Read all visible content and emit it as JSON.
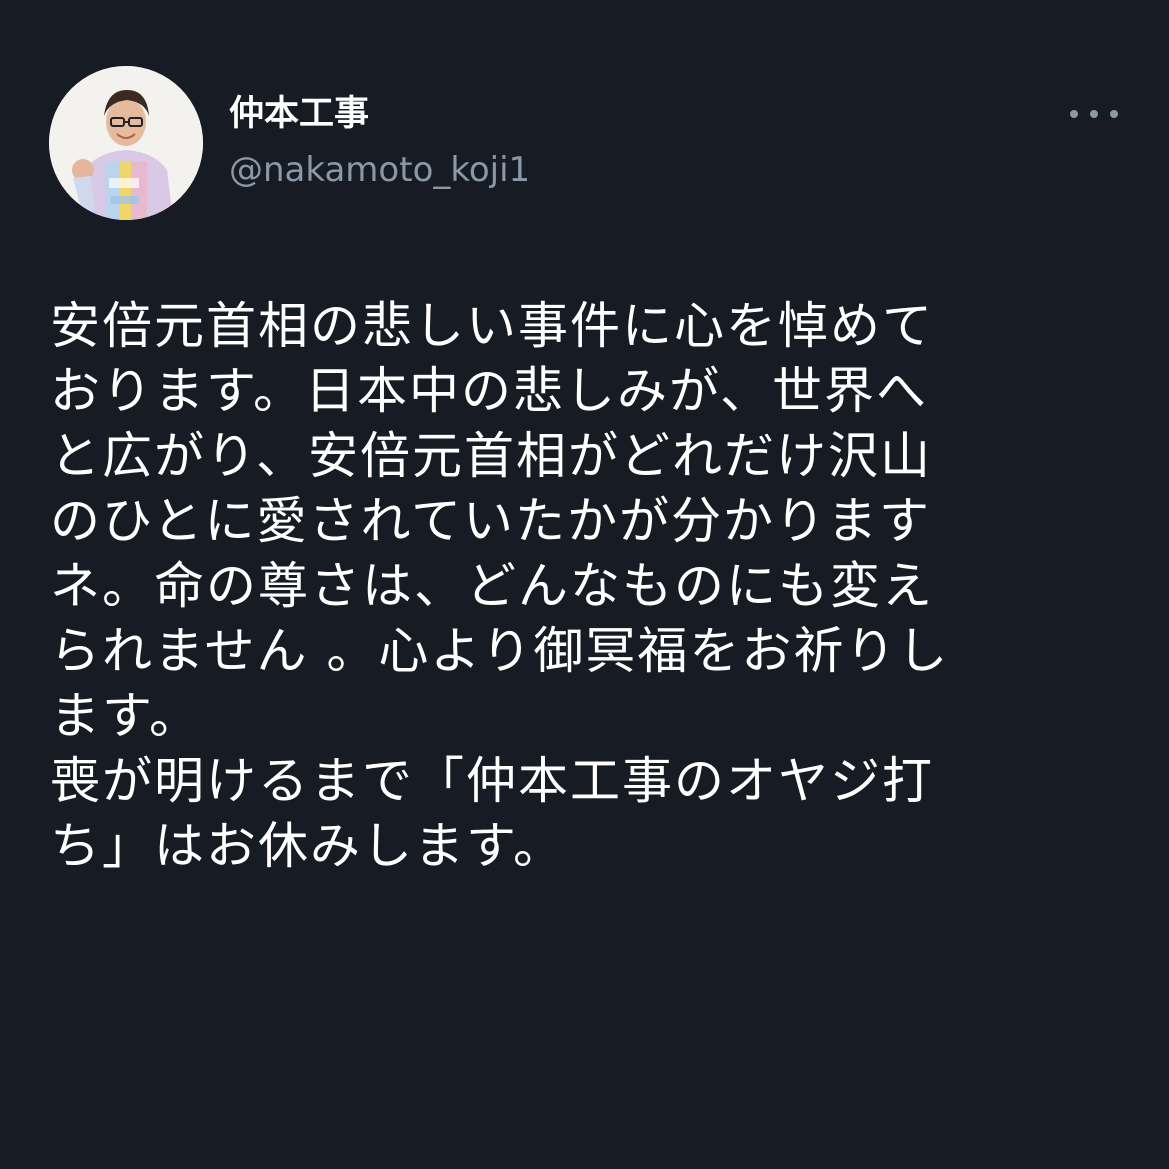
{
  "tweet": {
    "author": {
      "display_name": "仲本工事",
      "handle": "@nakamoto_koji1"
    },
    "more_icon": "more-horizontal-icon",
    "body_lines": [
      "安倍元首相の悲しい事件に心を悼めて",
      "おります。日本中の悲しみが、世界へ",
      "と広がり、安倍元首相がどれだけ沢山",
      "のひとに愛されていたかが分かります",
      "ネ。命の尊さは、どんなものにも変え",
      "られません 。心より御冥福をお祈りし",
      "ます。",
      "喪が明けるまで「仲本工事のオヤジ打",
      "ち」はお休みします。"
    ]
  },
  "colors": {
    "background": "#171c24",
    "text_primary": "#ffffff",
    "text_secondary": "#8b98a5"
  }
}
